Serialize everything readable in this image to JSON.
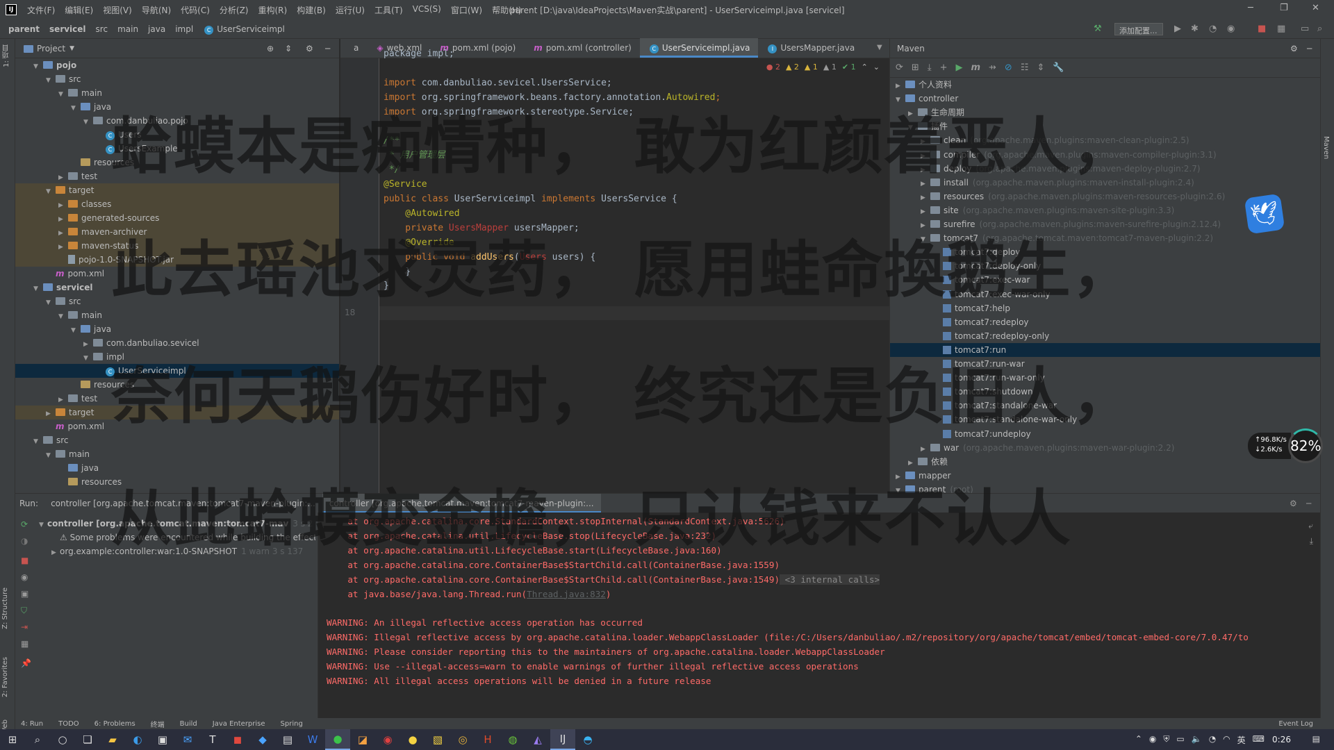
{
  "window": {
    "title": "parent [D:\\java\\IdeaProjects\\Maven实战\\parent] - UserServiceimpl.java [servicel]",
    "menu": [
      "文件(F)",
      "编辑(E)",
      "视图(V)",
      "导航(N)",
      "代码(C)",
      "分析(Z)",
      "重构(R)",
      "构建(B)",
      "运行(U)",
      "工具(T)",
      "VCS(S)",
      "窗口(W)",
      "帮助(H)"
    ]
  },
  "breadcrumb": [
    "parent",
    "servicel",
    "src",
    "main",
    "java",
    "impl",
    "UserServiceimpl"
  ],
  "toolbar": {
    "run_config": "添加配置..."
  },
  "left_strip": {
    "project_tab": "1: 项目",
    "structure_tab": "Z: Structure",
    "favorites_tab": "2: Favorites",
    "web_tab": "Web"
  },
  "project": {
    "header": "Project",
    "rows": [
      {
        "indent": 1,
        "arrow": "v",
        "icon": "folder-module",
        "label": "pojo",
        "bold": true
      },
      {
        "indent": 2,
        "arrow": "v",
        "icon": "folder",
        "label": "src"
      },
      {
        "indent": 3,
        "arrow": "v",
        "icon": "folder",
        "label": "main"
      },
      {
        "indent": 4,
        "arrow": "v",
        "icon": "folder-src",
        "label": "java"
      },
      {
        "indent": 5,
        "arrow": "v",
        "icon": "folder",
        "label": "com.danbuliao.pojo"
      },
      {
        "indent": 6,
        "arrow": "",
        "icon": "class",
        "label": "Users"
      },
      {
        "indent": 6,
        "arrow": "",
        "icon": "class",
        "label": "UsersExample"
      },
      {
        "indent": 4,
        "arrow": "",
        "icon": "folder-res",
        "label": "resources"
      },
      {
        "indent": 3,
        "arrow": ">",
        "icon": "folder",
        "label": "test"
      },
      {
        "indent": 2,
        "arrow": "v",
        "icon": "folder-orange",
        "label": "target",
        "target": true
      },
      {
        "indent": 3,
        "arrow": ">",
        "icon": "folder-orange",
        "label": "classes",
        "target": true
      },
      {
        "indent": 3,
        "arrow": ">",
        "icon": "folder-orange",
        "label": "generated-sources",
        "target": true
      },
      {
        "indent": 3,
        "arrow": ">",
        "icon": "folder-orange",
        "label": "maven-archiver",
        "target": true
      },
      {
        "indent": 3,
        "arrow": ">",
        "icon": "folder-orange",
        "label": "maven-status",
        "target": true
      },
      {
        "indent": 3,
        "arrow": "",
        "icon": "jar",
        "label": "pojo-1.0-SNAPSHOT.jar",
        "target": true
      },
      {
        "indent": 2,
        "arrow": "",
        "icon": "maven",
        "label": "pom.xml"
      },
      {
        "indent": 1,
        "arrow": "v",
        "icon": "folder-module",
        "label": "servicel",
        "bold": true
      },
      {
        "indent": 2,
        "arrow": "v",
        "icon": "folder",
        "label": "src"
      },
      {
        "indent": 3,
        "arrow": "v",
        "icon": "folder",
        "label": "main"
      },
      {
        "indent": 4,
        "arrow": "v",
        "icon": "folder-src",
        "label": "java"
      },
      {
        "indent": 5,
        "arrow": ">",
        "icon": "folder",
        "label": "com.danbuliao.sevicel"
      },
      {
        "indent": 5,
        "arrow": "v",
        "icon": "folder",
        "label": "impl"
      },
      {
        "indent": 6,
        "arrow": "",
        "icon": "class",
        "label": "UserServiceimpl",
        "selected": true
      },
      {
        "indent": 4,
        "arrow": "",
        "icon": "folder-res",
        "label": "resources"
      },
      {
        "indent": 3,
        "arrow": ">",
        "icon": "folder",
        "label": "test"
      },
      {
        "indent": 2,
        "arrow": ">",
        "icon": "folder-orange",
        "label": "target",
        "target": true
      },
      {
        "indent": 2,
        "arrow": "",
        "icon": "maven",
        "label": "pom.xml"
      },
      {
        "indent": 1,
        "arrow": "v",
        "icon": "folder",
        "label": "src"
      },
      {
        "indent": 2,
        "arrow": "v",
        "icon": "folder",
        "label": "main"
      },
      {
        "indent": 3,
        "arrow": "",
        "icon": "folder-src",
        "label": "java"
      },
      {
        "indent": 3,
        "arrow": "",
        "icon": "folder-res",
        "label": "resources"
      }
    ]
  },
  "editor": {
    "tabs": [
      {
        "label": "a",
        "active": false
      },
      {
        "label": "web.xml",
        "active": false
      },
      {
        "label": "pom.xml (pojo)",
        "active": false
      },
      {
        "label": "pom.xml (controller)",
        "active": false
      },
      {
        "label": "UserServiceimpl.java",
        "active": true
      },
      {
        "label": "UsersMapper.java",
        "active": false
      }
    ],
    "inspections": {
      "errors": "2",
      "warnings": "2",
      "weak": "1",
      "typos": "1",
      "ok": "1"
    },
    "current_line": "18",
    "lines": [
      [
        {
          "t": "package impl;",
          "c": "pl"
        }
      ],
      [],
      [
        {
          "t": "import ",
          "c": "kw"
        },
        {
          "t": "com.danbuliao.sevicel.UsersService;",
          "c": "pl"
        }
      ],
      [
        {
          "t": "import ",
          "c": "kw"
        },
        {
          "t": "org.springframework.beans.factory.annotation.",
          "c": "pl"
        },
        {
          "t": "Autowired",
          "c": "ann"
        },
        {
          "t": ";",
          "c": "kw"
        }
      ],
      [
        {
          "t": "import ",
          "c": "kw"
        },
        {
          "t": "org.springframework.stereotype.Service;",
          "c": "pl"
        }
      ],
      [],
      [
        {
          "t": "/**",
          "c": "cmt"
        }
      ],
      [
        {
          "t": " * 用户管理层",
          "c": "cmt"
        }
      ],
      [
        {
          "t": " */",
          "c": "cmt"
        }
      ],
      [
        {
          "t": "@Service",
          "c": "ann"
        }
      ],
      [
        {
          "t": "public class ",
          "c": "kw"
        },
        {
          "t": "UserServiceimpl",
          "c": "pl"
        },
        {
          "t": " implements ",
          "c": "kw"
        },
        {
          "t": "UsersService {",
          "c": "pl"
        }
      ],
      [
        {
          "t": "    @Autowired",
          "c": "ann"
        }
      ],
      [
        {
          "t": "    private ",
          "c": "kw"
        },
        {
          "t": "UsersMapper ",
          "c": "err"
        },
        {
          "t": "usersMapper;",
          "c": "pl"
        }
      ],
      [
        {
          "t": "    @Override",
          "c": "ann"
        }
      ],
      [
        {
          "t": "    public void ",
          "c": "kw"
        },
        {
          "t": "addUsers",
          "c": "fn"
        },
        {
          "t": "(",
          "c": "pl"
        },
        {
          "t": "Users",
          "c": "err"
        },
        {
          "t": " users) {",
          "c": "pl"
        }
      ],
      [
        {
          "t": "    }",
          "c": "pl"
        }
      ],
      [
        {
          "t": "}",
          "c": "pl"
        }
      ],
      []
    ]
  },
  "maven": {
    "header": "Maven",
    "rows": [
      {
        "indent": 0,
        "arrow": ">",
        "icon": "module",
        "label": "个人资料",
        "extra": ""
      },
      {
        "indent": 0,
        "arrow": "v",
        "icon": "module",
        "label": "controller",
        "extra": ""
      },
      {
        "indent": 1,
        "arrow": ">",
        "icon": "folder",
        "label": "生命周期",
        "extra": ""
      },
      {
        "indent": 1,
        "arrow": "v",
        "icon": "folder",
        "label": "插件",
        "extra": ""
      },
      {
        "indent": 2,
        "arrow": ">",
        "icon": "plugin",
        "label": "clean",
        "extra": "(org.apache.maven.plugins:maven-clean-plugin:2.5)"
      },
      {
        "indent": 2,
        "arrow": ">",
        "icon": "plugin",
        "label": "compiler",
        "extra": "(org.apache.maven.plugins:maven-compiler-plugin:3.1)"
      },
      {
        "indent": 2,
        "arrow": ">",
        "icon": "plugin",
        "label": "deploy",
        "extra": "(org.apache.maven.plugins:maven-deploy-plugin:2.7)"
      },
      {
        "indent": 2,
        "arrow": ">",
        "icon": "plugin",
        "label": "install",
        "extra": "(org.apache.maven.plugins:maven-install-plugin:2.4)"
      },
      {
        "indent": 2,
        "arrow": ">",
        "icon": "plugin",
        "label": "resources",
        "extra": "(org.apache.maven.plugins:maven-resources-plugin:2.6)"
      },
      {
        "indent": 2,
        "arrow": ">",
        "icon": "plugin",
        "label": "site",
        "extra": "(org.apache.maven.plugins:maven-site-plugin:3.3)"
      },
      {
        "indent": 2,
        "arrow": ">",
        "icon": "plugin",
        "label": "surefire",
        "extra": "(org.apache.maven.plugins:maven-surefire-plugin:2.12.4)"
      },
      {
        "indent": 2,
        "arrow": "v",
        "icon": "plugin",
        "label": "tomcat7",
        "extra": "(org.apache.tomcat.maven:tomcat7-maven-plugin:2.2)"
      },
      {
        "indent": 3,
        "arrow": "",
        "icon": "goal",
        "label": "tomcat7:deploy",
        "extra": ""
      },
      {
        "indent": 3,
        "arrow": "",
        "icon": "goal",
        "label": "tomcat7:deploy-only",
        "extra": ""
      },
      {
        "indent": 3,
        "arrow": "",
        "icon": "goal",
        "label": "tomcat7:exec-war",
        "extra": ""
      },
      {
        "indent": 3,
        "arrow": "",
        "icon": "goal",
        "label": "tomcat7:exec-war-only",
        "extra": ""
      },
      {
        "indent": 3,
        "arrow": "",
        "icon": "goal",
        "label": "tomcat7:help",
        "extra": ""
      },
      {
        "indent": 3,
        "arrow": "",
        "icon": "goal",
        "label": "tomcat7:redeploy",
        "extra": ""
      },
      {
        "indent": 3,
        "arrow": "",
        "icon": "goal",
        "label": "tomcat7:redeploy-only",
        "extra": ""
      },
      {
        "indent": 3,
        "arrow": "",
        "icon": "goal",
        "label": "tomcat7:run",
        "extra": "",
        "selected": true
      },
      {
        "indent": 3,
        "arrow": "",
        "icon": "goal",
        "label": "tomcat7:run-war",
        "extra": ""
      },
      {
        "indent": 3,
        "arrow": "",
        "icon": "goal",
        "label": "tomcat7:run-war-only",
        "extra": ""
      },
      {
        "indent": 3,
        "arrow": "",
        "icon": "goal",
        "label": "tomcat7:shutdown",
        "extra": ""
      },
      {
        "indent": 3,
        "arrow": "",
        "icon": "goal",
        "label": "tomcat7:standalone-war",
        "extra": ""
      },
      {
        "indent": 3,
        "arrow": "",
        "icon": "goal",
        "label": "tomcat7:standalone-war-only",
        "extra": ""
      },
      {
        "indent": 3,
        "arrow": "",
        "icon": "goal",
        "label": "tomcat7:undeploy",
        "extra": ""
      },
      {
        "indent": 2,
        "arrow": ">",
        "icon": "plugin",
        "label": "war",
        "extra": "(org.apache.maven.plugins:maven-war-plugin:2.2)"
      },
      {
        "indent": 1,
        "arrow": ">",
        "icon": "folder",
        "label": "依赖",
        "extra": ""
      },
      {
        "indent": 0,
        "arrow": ">",
        "icon": "module",
        "label": "mapper",
        "extra": ""
      },
      {
        "indent": 0,
        "arrow": "v",
        "icon": "module",
        "label": "parent",
        "extra": "(root)"
      }
    ]
  },
  "run": {
    "label": "Run:",
    "tabs": [
      {
        "label": "controller [org.apache.tomcat.maven:tomcat7-maven-plugin:...",
        "active": false
      },
      {
        "label": "controller [org.apache.tomcat.maven:tomcat7-maven-plugin:...",
        "active": true
      }
    ],
    "tree": [
      {
        "indent": 0,
        "label": "controller [org.apache.tomcat.maven:tomcat7-mav",
        "extra": "3 s 2",
        "bold": true
      },
      {
        "indent": 1,
        "label": "Some problems were encountered while building the effect",
        "extra": "",
        "warn": true
      },
      {
        "indent": 1,
        "label": "org.example:controller:war:1.0-SNAPSHOT",
        "extra": "1 warn 3 s 137"
      }
    ],
    "console": [
      {
        "text": "    at org.apache.catalina.core.StandardContext.stopInternal(StandardContext.java:5626)"
      },
      {
        "text": "    at org.apache.catalina.util.LifecycleBase.stop(LifecycleBase.java:232)"
      },
      {
        "text": "    at org.apache.catalina.util.LifecycleBase.start(LifecycleBase.java:160)"
      },
      {
        "text": "    at org.apache.catalina.core.ContainerBase$StartChild.call(ContainerBase.java:1559)"
      },
      {
        "text": "    at org.apache.catalina.core.ContainerBase$StartChild.call(ContainerBase.java:1549)",
        "hint": " <3 internal calls>"
      },
      {
        "text": "    at java.base/java.lang.Thread.run(",
        "link": "Thread.java:832",
        "tail": ")"
      },
      {
        "text": ""
      },
      {
        "text": "WARNING: An illegal reflective access operation has occurred"
      },
      {
        "text": "WARNING: Illegal reflective access by org.apache.catalina.loader.WebappClassLoader (file:/C:/Users/danbuliao/.m2/repository/org/apache/tomcat/embed/tomcat-embed-core/7.0.47/to"
      },
      {
        "text": "WARNING: Please consider reporting this to the maintainers of org.apache.catalina.loader.WebappClassLoader"
      },
      {
        "text": "WARNING: Use --illegal-access=warn to enable warnings of further illegal reflective access operations"
      },
      {
        "text": "WARNING: All illegal access operations will be denied in a future release"
      }
    ]
  },
  "bottom_tabs": [
    "4: Run",
    "TODO",
    "6: Problems",
    "终端",
    "Build",
    "Java Enterprise",
    "Spring",
    "Event Log"
  ],
  "taskbar": {
    "clock": "0:26",
    "ime": "英"
  },
  "network": {
    "up": "96.8K/s",
    "down": "2.6K/s",
    "percent": "82%"
  },
  "overlay_poem": [
    "蛤蟆本是痴情种， 敢为红颜着恶人，",
    "此去瑶池求灵药， 愿用蛙命換鹅生，",
    "奈何天鹅伤好时， 终究还是负旧人，",
    "从此蛤蟆变金蟾， 只认钱来不认人"
  ],
  "colors": {
    "accent": "#4a88c7",
    "selection": "#0d293e",
    "error_text": "#ff6b68",
    "bg": "#2b2b2b",
    "panel": "#3c3f41"
  }
}
